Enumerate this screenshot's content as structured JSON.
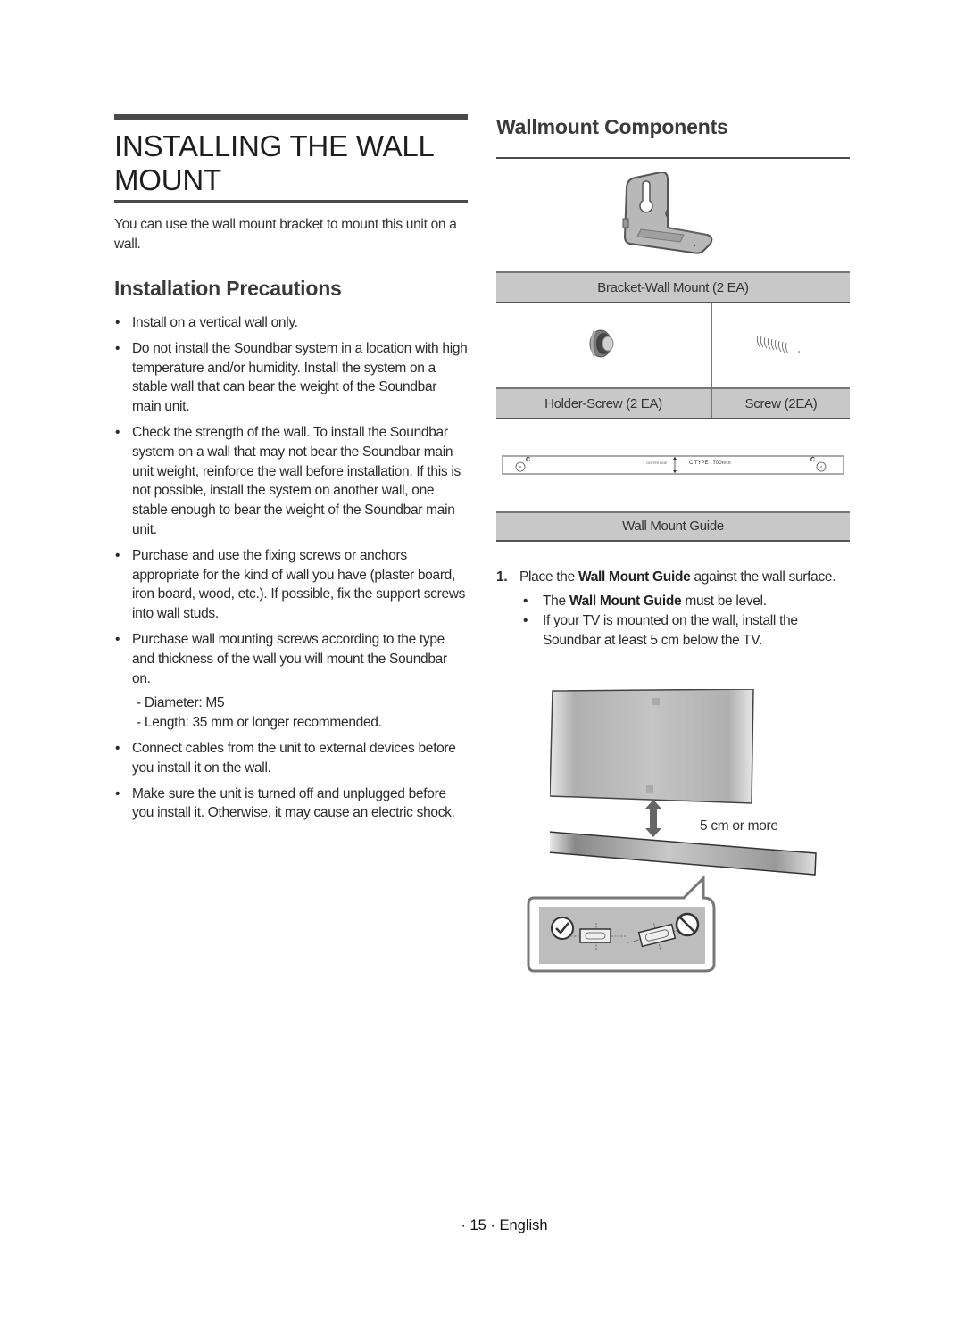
{
  "left": {
    "title": "INSTALLING THE WALL MOUNT",
    "title_line1": "INSTALLING THE WALL",
    "title_line2": "MOUNT",
    "intro": "You can use the wall mount bracket to mount this unit on a wall.",
    "section_heading": "Installation Precautions",
    "bullet_glyph": "•",
    "precautions": [
      "Install on a vertical wall only.",
      "Do not install the Soundbar system in a location with high temperature and/or humidity. Install the system on a stable wall that can bear the weight of the Soundbar main unit.",
      "Check the strength of the wall. To install the Soundbar system on a wall that may not bear the Soundbar main unit weight, reinforce the wall before installation. If this is not possible, install the system on another wall, one stable enough to bear the weight of the Soundbar main unit.",
      "Purchase and use the fixing screws or anchors appropriate for the kind of wall you have (plaster board, iron board, wood, etc.). If possible, fix the support screws into wall studs.",
      "Purchase wall mounting screws according to the type and thickness of the wall you will mount the Soundbar on.",
      "Connect cables from the unit to external devices before you install it on the wall.",
      "Make sure the unit is turned off and unplugged before you install it. Otherwise, it may cause an electric shock."
    ],
    "screw_specs": [
      "- Diameter: M5",
      "- Length: 35 mm or longer recommended."
    ]
  },
  "right": {
    "heading": "Wallmount Components",
    "components": {
      "bracket": "Bracket-Wall Mount (2 EA)",
      "holder_screw": "Holder-Screw (2 EA)",
      "screw": "Screw (2EA)",
      "guide": "Wall Mount Guide"
    },
    "guide_strip": {
      "left_mark": "C",
      "right_mark": "C",
      "center_label": "CENTER LINE",
      "type_label": "C TYPE : 700mm"
    },
    "step": {
      "number": "1.",
      "text_before": "Place the ",
      "bold": "Wall Mount Guide",
      "text_after": " against the wall surface.",
      "sub_glyph": "•",
      "sub1_before": "The ",
      "sub1_bold": "Wall Mount Guide",
      "sub1_after": " must be level.",
      "sub2": "If your TV is mounted on the wall, install the Soundbar at least 5 cm below the TV."
    },
    "diagram_note": "5 cm or more"
  },
  "footer": {
    "page_label": "· 15 · English"
  }
}
